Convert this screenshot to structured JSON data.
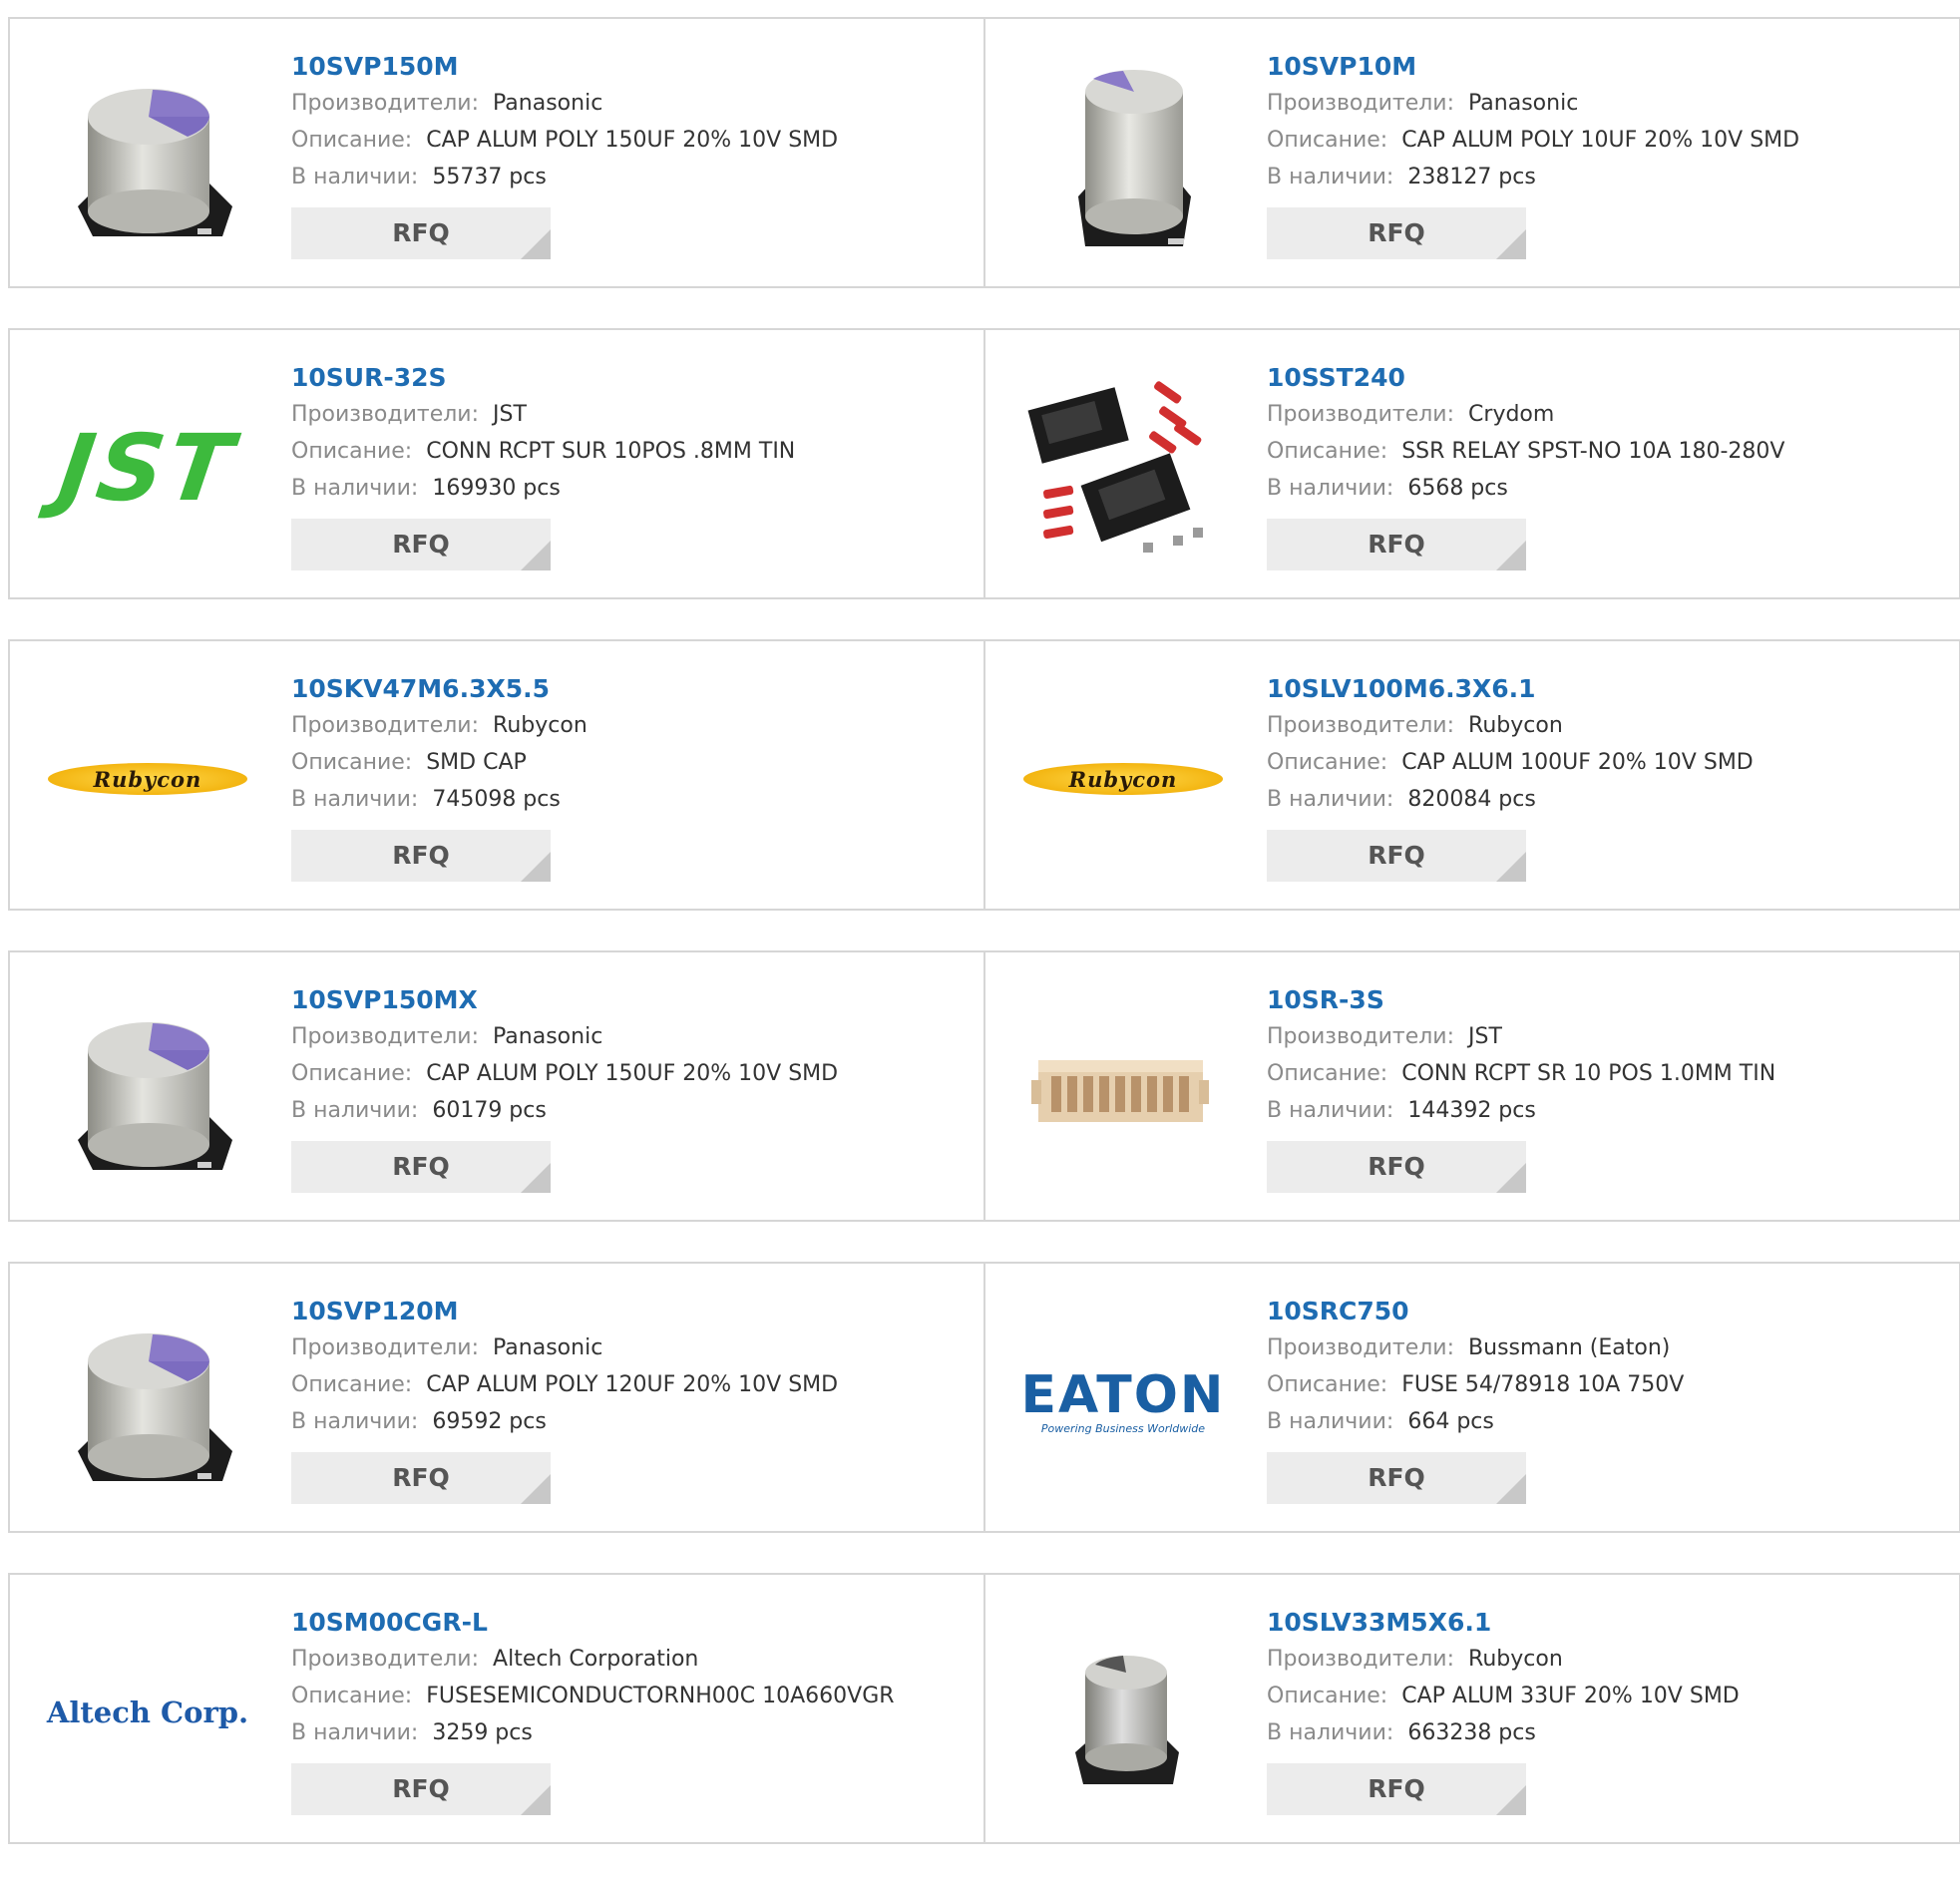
{
  "labels": {
    "manufacturer": "Производители:",
    "description": "Описание:",
    "stock": "В наличии:",
    "rfq": "RFQ"
  },
  "products": [
    {
      "pn": "10SVP150M",
      "manufacturer": "Panasonic",
      "description": "CAP ALUM POLY 150UF 20% 10V SMD",
      "stock": "55737 pcs",
      "image": "capacitor-wide-purple"
    },
    {
      "pn": "10SVP10M",
      "manufacturer": "Panasonic",
      "description": "CAP ALUM POLY 10UF 20% 10V SMD",
      "stock": "238127 pcs",
      "image": "capacitor-tall-purple"
    },
    {
      "pn": "10SUR-32S",
      "manufacturer": "JST",
      "description": "CONN RCPT SUR 10POS .8MM TIN",
      "stock": "169930 pcs",
      "image": "logo",
      "logo_text": "JST"
    },
    {
      "pn": "10SST240",
      "manufacturer": "Crydom",
      "description": "SSR RELAY SPST-NO 10A 180-280V",
      "stock": "6568 pcs",
      "image": "relay-kit"
    },
    {
      "pn": "10SKV47M6.3X5.5",
      "manufacturer": "Rubycon",
      "description": "SMD CAP",
      "stock": "745098 pcs",
      "image": "logo",
      "logo_text": "Rubycon"
    },
    {
      "pn": "10SLV100M6.3X6.1",
      "manufacturer": "Rubycon",
      "description": "CAP ALUM 100UF 20% 10V SMD",
      "stock": "820084 pcs",
      "image": "logo",
      "logo_text": "Rubycon"
    },
    {
      "pn": "10SVP150MX",
      "manufacturer": "Panasonic",
      "description": "CAP ALUM POLY 150UF 20% 10V SMD",
      "stock": "60179 pcs",
      "image": "capacitor-wide-purple"
    },
    {
      "pn": "10SR-3S",
      "manufacturer": "JST",
      "description": "CONN RCPT SR 10 POS 1.0MM TIN",
      "stock": "144392 pcs",
      "image": "connector-header"
    },
    {
      "pn": "10SVP120M",
      "manufacturer": "Panasonic",
      "description": "CAP ALUM POLY 120UF 20% 10V SMD",
      "stock": "69592 pcs",
      "image": "capacitor-wide-purple"
    },
    {
      "pn": "10SRC750",
      "manufacturer": "Bussmann (Eaton)",
      "description": "FUSE 54/78918 10A 750V",
      "stock": "664 pcs",
      "image": "logo",
      "logo_text": "EATON",
      "logo_tagline": "Powering Business Worldwide"
    },
    {
      "pn": "10SM00CGR-L",
      "manufacturer": "Altech Corporation",
      "description": "FUSESEMICONDUCTORNH00C 10A660VGR",
      "stock": "3259 pcs",
      "image": "logo",
      "logo_text": "Altech Corp."
    },
    {
      "pn": "10SLV33M5X6.1",
      "manufacturer": "Rubycon",
      "description": "CAP ALUM 33UF 20% 10V SMD",
      "stock": "663238 pcs",
      "image": "capacitor-small-plain"
    }
  ]
}
